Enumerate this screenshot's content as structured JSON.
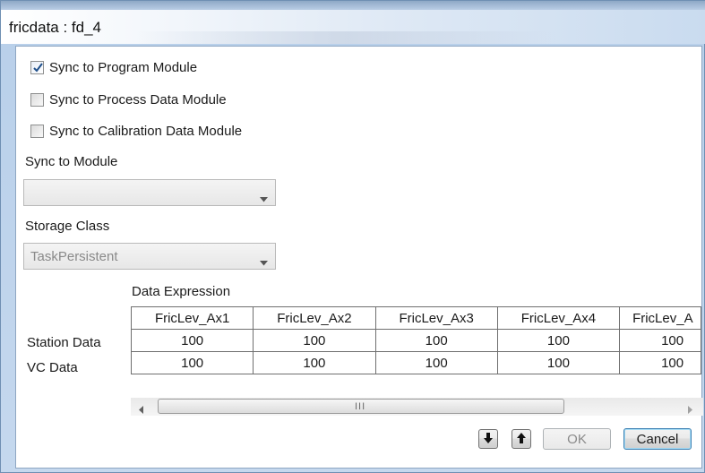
{
  "window": {
    "title": "fricdata : fd_4"
  },
  "checkboxes": [
    {
      "label": "Sync to Program Module",
      "checked": true
    },
    {
      "label": "Sync to Process Data Module",
      "checked": false
    },
    {
      "label": "Sync to Calibration Data Module",
      "checked": false
    }
  ],
  "sync_module": {
    "label": "Sync to Module",
    "value": ""
  },
  "storage_class": {
    "label": "Storage Class",
    "value": "TaskPersistent"
  },
  "grid": {
    "caption": "Data Expression",
    "columns": [
      "FricLev_Ax1",
      "FricLev_Ax2",
      "FricLev_Ax3",
      "FricLev_Ax4",
      "FricLev_A"
    ],
    "rows": [
      {
        "label": "Station Data",
        "values": [
          "100",
          "100",
          "100",
          "100",
          "100"
        ]
      },
      {
        "label": "VC Data",
        "values": [
          "100",
          "100",
          "100",
          "100",
          "100"
        ]
      }
    ]
  },
  "buttons": {
    "ok": "OK",
    "cancel": "Cancel"
  },
  "colors": {
    "default_button_border": "#3c7fb1",
    "check_mark": "#1f4f8a"
  }
}
